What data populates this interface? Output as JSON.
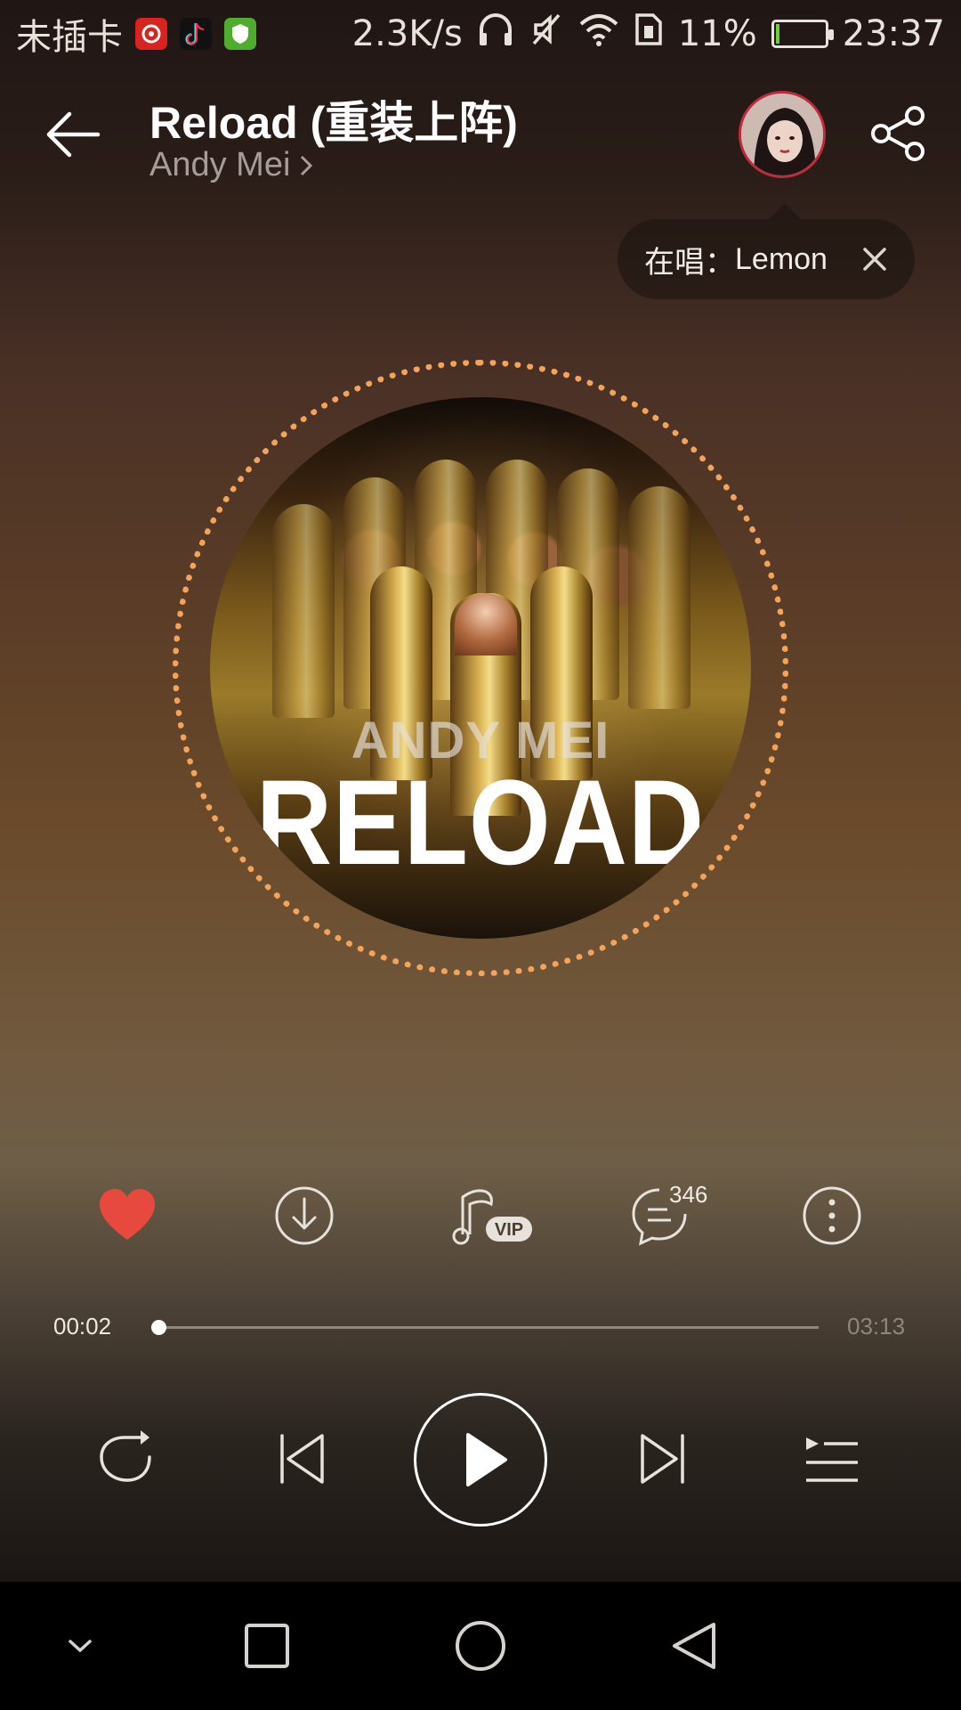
{
  "status_bar": {
    "carrier": "未插卡",
    "net_speed": "2.3K/s",
    "battery_percent": "11%",
    "battery_level": 0.11,
    "time": "23:37"
  },
  "header": {
    "title": "Reload (重装上阵)",
    "artist": "Andy Mei"
  },
  "now_singing": {
    "label": "在唱：",
    "song": "Lemon"
  },
  "album_art": {
    "artist_text": "ANDY MEI",
    "title_text": "RELOAD"
  },
  "actions": {
    "comment_count": "346",
    "liked": true
  },
  "player": {
    "current_time": "00:02",
    "total_time": "03:13",
    "progress": 0.01,
    "state": "paused"
  },
  "colors": {
    "like_red": "#e8493f",
    "ring_orange": "#f3a45a"
  }
}
